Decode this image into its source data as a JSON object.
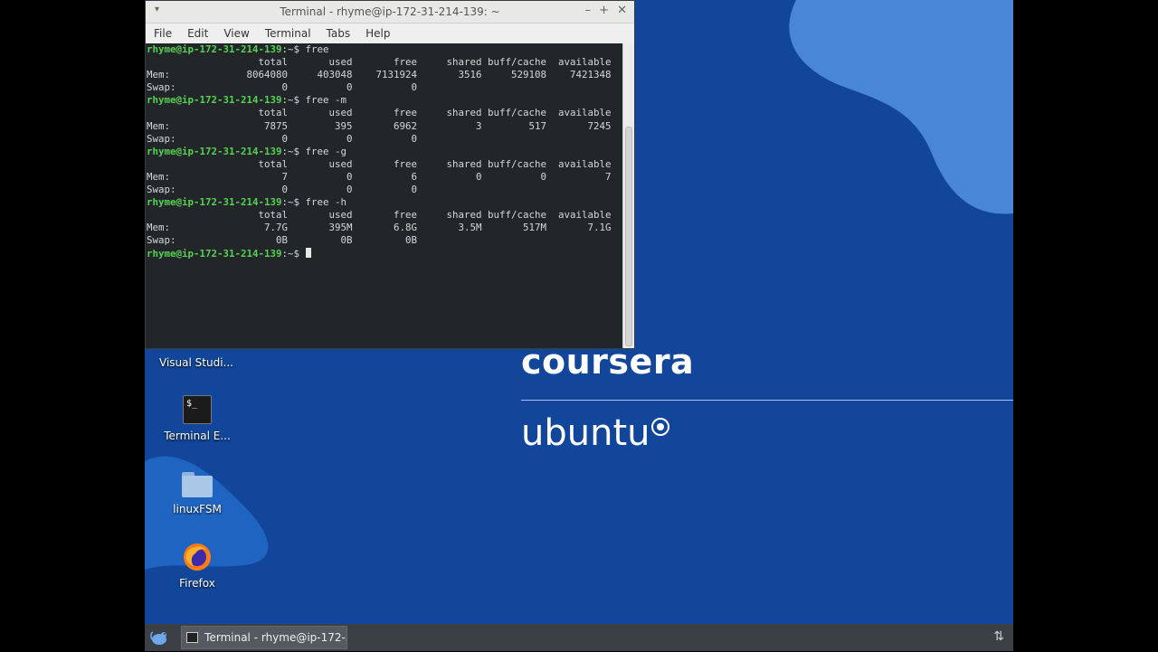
{
  "window": {
    "title": "Terminal - rhyme@ip-172-31-214-139: ~",
    "menu": [
      "File",
      "Edit",
      "View",
      "Terminal",
      "Tabs",
      "Help"
    ]
  },
  "terminal": {
    "prompt": "rhyme@ip-172-31-214-139",
    "blocks": [
      {
        "command": "free",
        "header": [
          "total",
          "used",
          "free",
          "shared",
          "buff/cache",
          "available"
        ],
        "rows": [
          {
            "label": "Mem:",
            "values": [
              "8064080",
              "403048",
              "7131924",
              "3516",
              "529108",
              "7421348"
            ]
          },
          {
            "label": "Swap:",
            "values": [
              "0",
              "0",
              "0"
            ]
          }
        ]
      },
      {
        "command": "free -m",
        "header": [
          "total",
          "used",
          "free",
          "shared",
          "buff/cache",
          "available"
        ],
        "rows": [
          {
            "label": "Mem:",
            "values": [
              "7875",
              "395",
              "6962",
              "3",
              "517",
              "7245"
            ]
          },
          {
            "label": "Swap:",
            "values": [
              "0",
              "0",
              "0"
            ]
          }
        ]
      },
      {
        "command": "free -g",
        "header": [
          "total",
          "used",
          "free",
          "shared",
          "buff/cache",
          "available"
        ],
        "rows": [
          {
            "label": "Mem:",
            "values": [
              "7",
              "0",
              "6",
              "0",
              "0",
              "7"
            ]
          },
          {
            "label": "Swap:",
            "values": [
              "0",
              "0",
              "0"
            ]
          }
        ]
      },
      {
        "command": "free -h",
        "header": [
          "total",
          "used",
          "free",
          "shared",
          "buff/cache",
          "available"
        ],
        "rows": [
          {
            "label": "Mem:",
            "values": [
              "7.7G",
              "395M",
              "6.8G",
              "3.5M",
              "517M",
              "7.1G"
            ]
          },
          {
            "label": "Swap:",
            "values": [
              "0B",
              "0B",
              "0B"
            ]
          }
        ]
      }
    ]
  },
  "desktop": {
    "icons": [
      {
        "label": "Visual Studi...",
        "icon": "vscode-icon"
      },
      {
        "label": "Terminal E...",
        "icon": "terminal-icon"
      },
      {
        "label": "linuxFSM",
        "icon": "folder-icon"
      },
      {
        "label": "Firefox",
        "icon": "firefox-icon"
      }
    ],
    "brand_coursera": "coursera",
    "brand_ubuntu": "ubuntu"
  },
  "taskbar": {
    "task_label": "Terminal - rhyme@ip-172-31...",
    "start_icon": "xfce-mouse-icon",
    "tray_icon": "network-arrows-icon"
  },
  "colors": {
    "desktop_bg": "#12469a",
    "terminal_bg": "#232629",
    "prompt_green": "#55d155"
  }
}
